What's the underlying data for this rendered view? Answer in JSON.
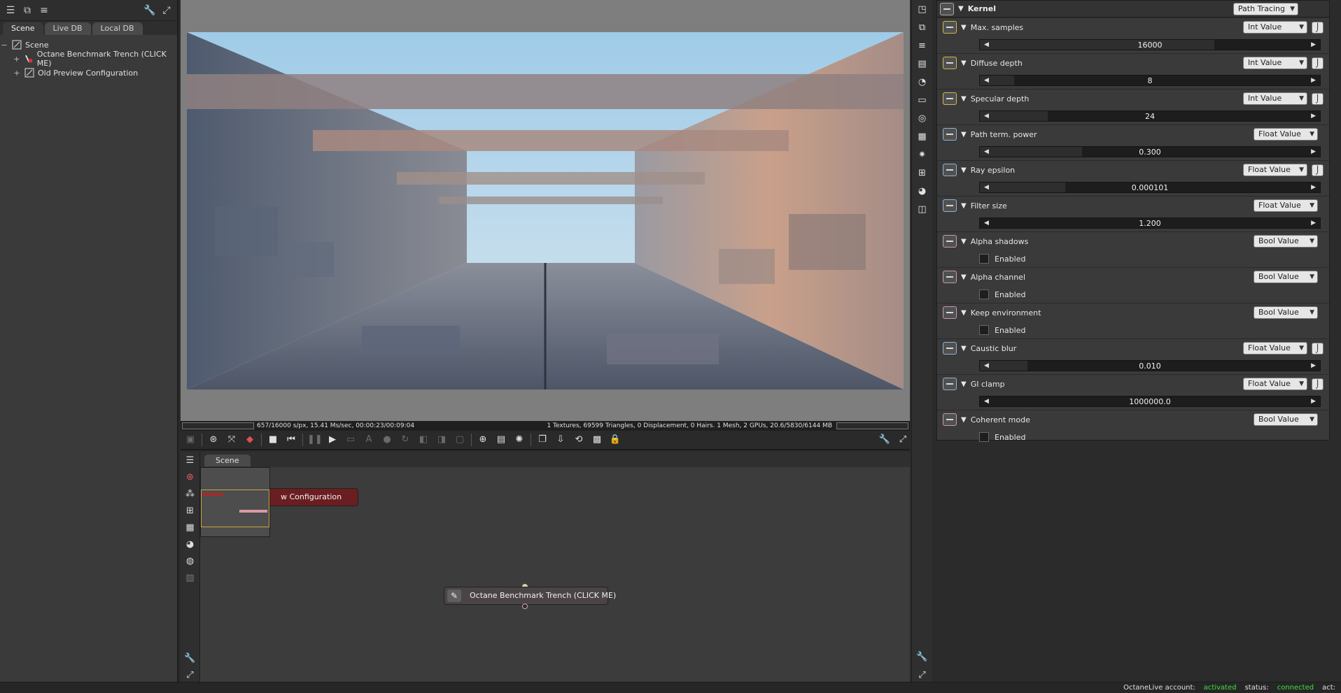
{
  "left_panel": {
    "tabs": [
      "Scene",
      "Live DB",
      "Local DB"
    ],
    "tree": [
      {
        "label": "Scene",
        "expander": "−"
      },
      {
        "label": "Octane Benchmark Trench (CLICK ME)",
        "expander": "+"
      },
      {
        "label": "Old Preview Configuration",
        "expander": "+"
      }
    ]
  },
  "viewport": {
    "status_left": "657/16000 s/px, 15.41 Ms/sec, 00:00:23/00:09:04",
    "status_right": "1 Textures, 69599 Triangles, 0 Displacement, 0 Hairs. 1 Mesh, 2 GPUs, 20.6/5830/6144 MB"
  },
  "graph": {
    "tab": "Scene",
    "node_red_label": "w Configuration",
    "node_main_label": "Octane Benchmark Trench (CLICK ME)"
  },
  "params": {
    "header": {
      "title": "Kernel",
      "type": "Path Tracing"
    },
    "items": [
      {
        "name": "Max. samples",
        "kind": "int",
        "type": "Int Value",
        "value": "16000",
        "fraction": 0.69
      },
      {
        "name": "Diffuse depth",
        "kind": "int",
        "type": "Int Value",
        "value": "8",
        "fraction": 0.1
      },
      {
        "name": "Specular depth",
        "kind": "int",
        "type": "Int Value",
        "value": "24",
        "fraction": 0.2
      },
      {
        "name": "Path term. power",
        "kind": "float",
        "type": "Float Value",
        "value": "0.300",
        "fraction": 0.3
      },
      {
        "name": "Ray epsilon",
        "kind": "float",
        "type": "Float Value",
        "value": "0.000101",
        "fraction": 0.25
      },
      {
        "name": "Filter size",
        "kind": "float",
        "type": "Float Value",
        "value": "1.200",
        "fraction": 0.0
      },
      {
        "name": "Alpha shadows",
        "kind": "bool",
        "type": "Bool Value",
        "check_label": "Enabled"
      },
      {
        "name": "Alpha channel",
        "kind": "bool",
        "type": "Bool Value",
        "check_label": "Enabled"
      },
      {
        "name": "Keep environment",
        "kind": "bool",
        "type": "Bool Value",
        "check_label": "Enabled"
      },
      {
        "name": "Caustic blur",
        "kind": "float",
        "type": "Float Value",
        "value": "0.010",
        "fraction": 0.14
      },
      {
        "name": "GI clamp",
        "kind": "float",
        "type": "Float Value",
        "value": "1000000.0",
        "fraction": 0.0
      },
      {
        "name": "Coherent mode",
        "kind": "bool",
        "type": "Bool Value",
        "check_label": "Enabled"
      }
    ]
  },
  "bottom_status": {
    "account_label": "OctaneLive account:",
    "account_value": "activated",
    "status_label": "status:",
    "status_value": "connected",
    "act_label": "act:"
  }
}
